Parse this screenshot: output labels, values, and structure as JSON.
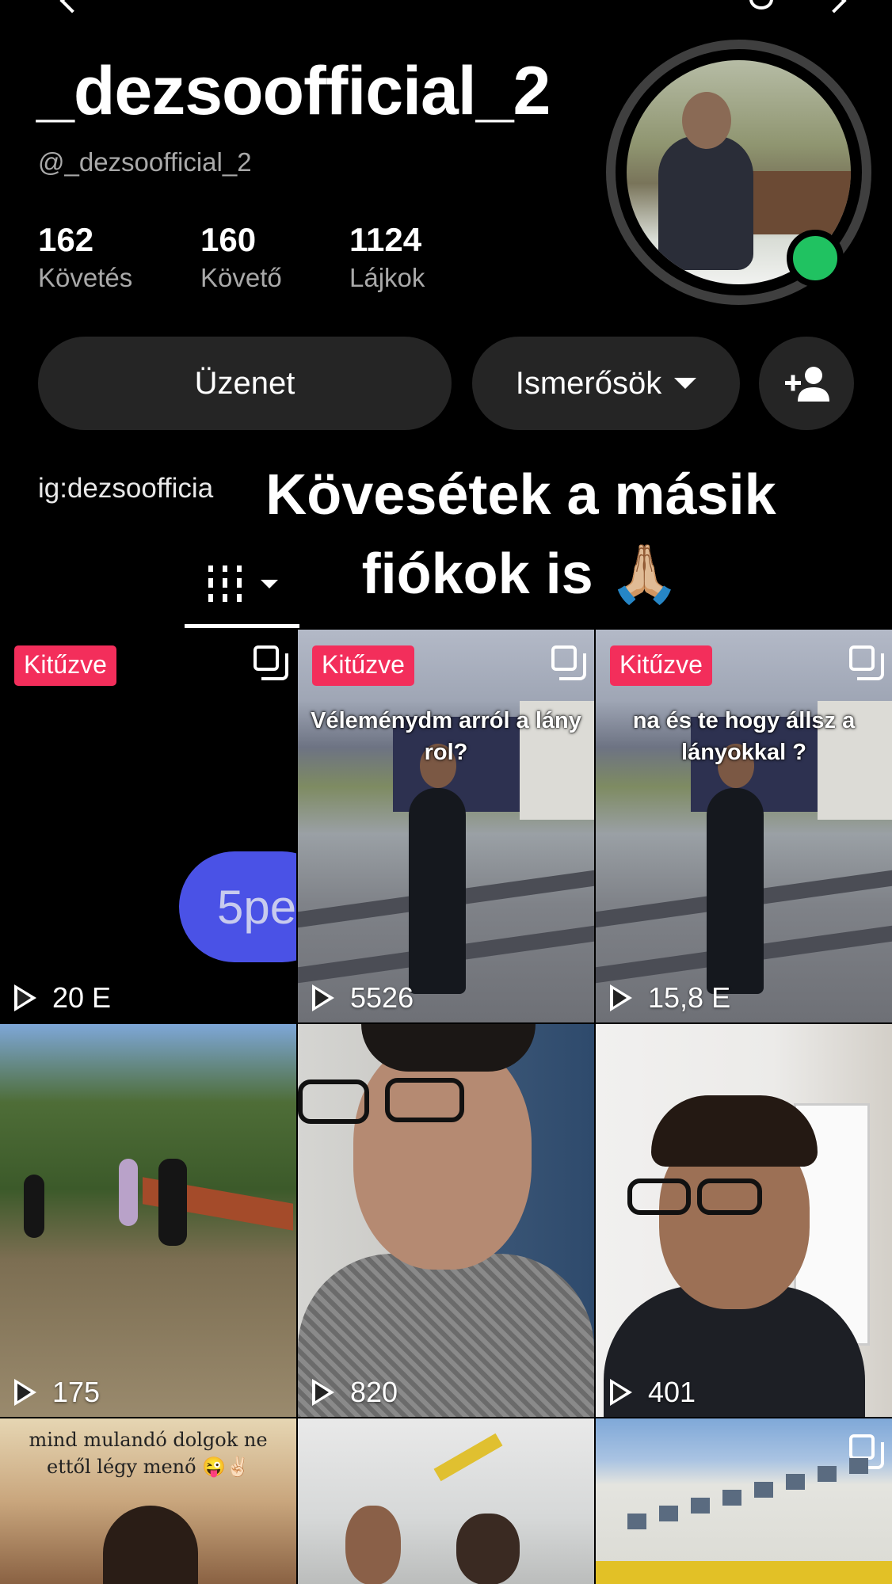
{
  "profile": {
    "username": "_dezsoofficial_2",
    "handle": "@_dezsoofficial_2",
    "stats": [
      {
        "value": "162",
        "label": "Követés"
      },
      {
        "value": "160",
        "label": "Követő"
      },
      {
        "value": "1124",
        "label": "Lájkok"
      }
    ],
    "online_color": "#20c261"
  },
  "actions": {
    "message_label": "Üzenet",
    "friends_label": "Ismerősök",
    "add_friend_icon": "add-user-icon"
  },
  "bio": "ig:dezsoofficia",
  "overlay_text": [
    "Kövesétek a másik",
    "fiókok is 🙏🏼"
  ],
  "tabs": {
    "active_icon": "videos-grid-icon"
  },
  "videos": [
    {
      "pinned": "Kitűzve",
      "views": "20 E",
      "caption": "",
      "inner_text": "5pe",
      "multi": true
    },
    {
      "pinned": "Kitűzve",
      "views": "5526",
      "caption": "Véleménydm arról a lány rol?",
      "multi": true
    },
    {
      "pinned": "Kitűzve",
      "views": "15,8 E",
      "caption": "na és te hogy állsz a lányokkal ?",
      "multi": true
    },
    {
      "pinned": "",
      "views": "175",
      "caption": ""
    },
    {
      "pinned": "",
      "views": "820",
      "caption": ""
    },
    {
      "pinned": "",
      "views": "401",
      "caption": ""
    },
    {
      "pinned": "",
      "views": "",
      "caption": "mind mulandó dolgok ne ettől légy menő 😜✌🏻"
    },
    {
      "pinned": "",
      "views": "",
      "caption": ""
    },
    {
      "pinned": "",
      "views": "",
      "caption": "",
      "multi": true
    }
  ],
  "colors": {
    "accent_pinned": "#f32e5b",
    "button_bg": "#252525",
    "secondary_text": "#a9a9a9"
  }
}
